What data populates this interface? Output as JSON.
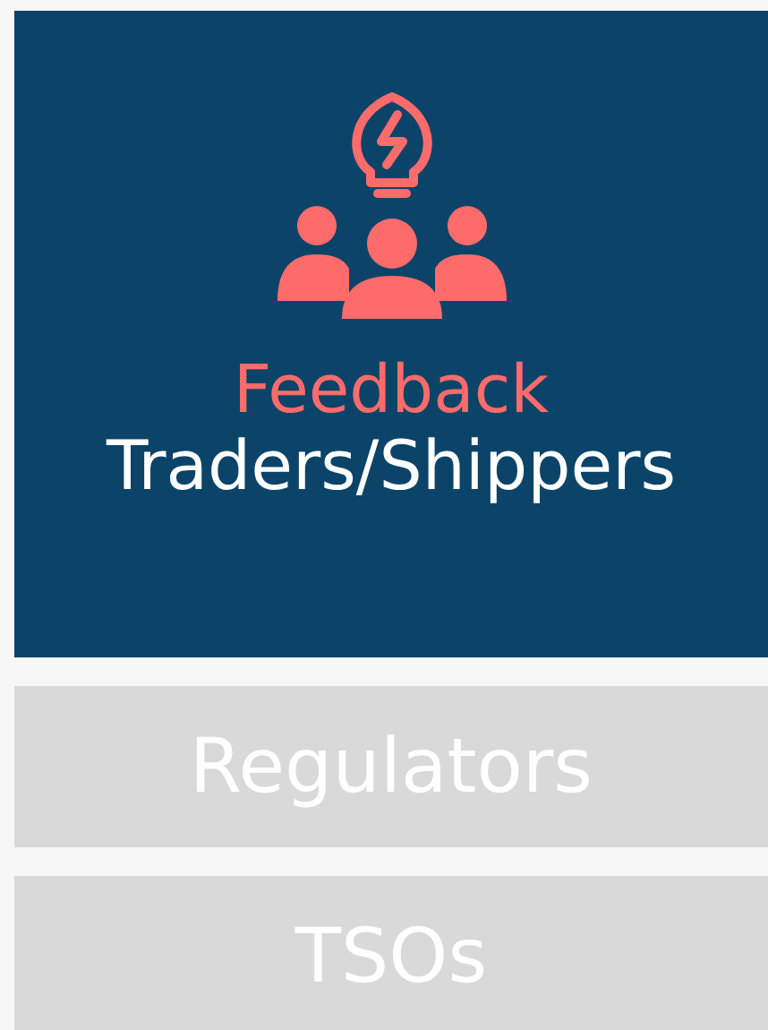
{
  "panels": [
    {
      "title": "Feedback",
      "label": "Traders/Shippers",
      "selected": true
    },
    {
      "label": "Regulators",
      "selected": false
    },
    {
      "label": "TSOs",
      "selected": false
    }
  ]
}
